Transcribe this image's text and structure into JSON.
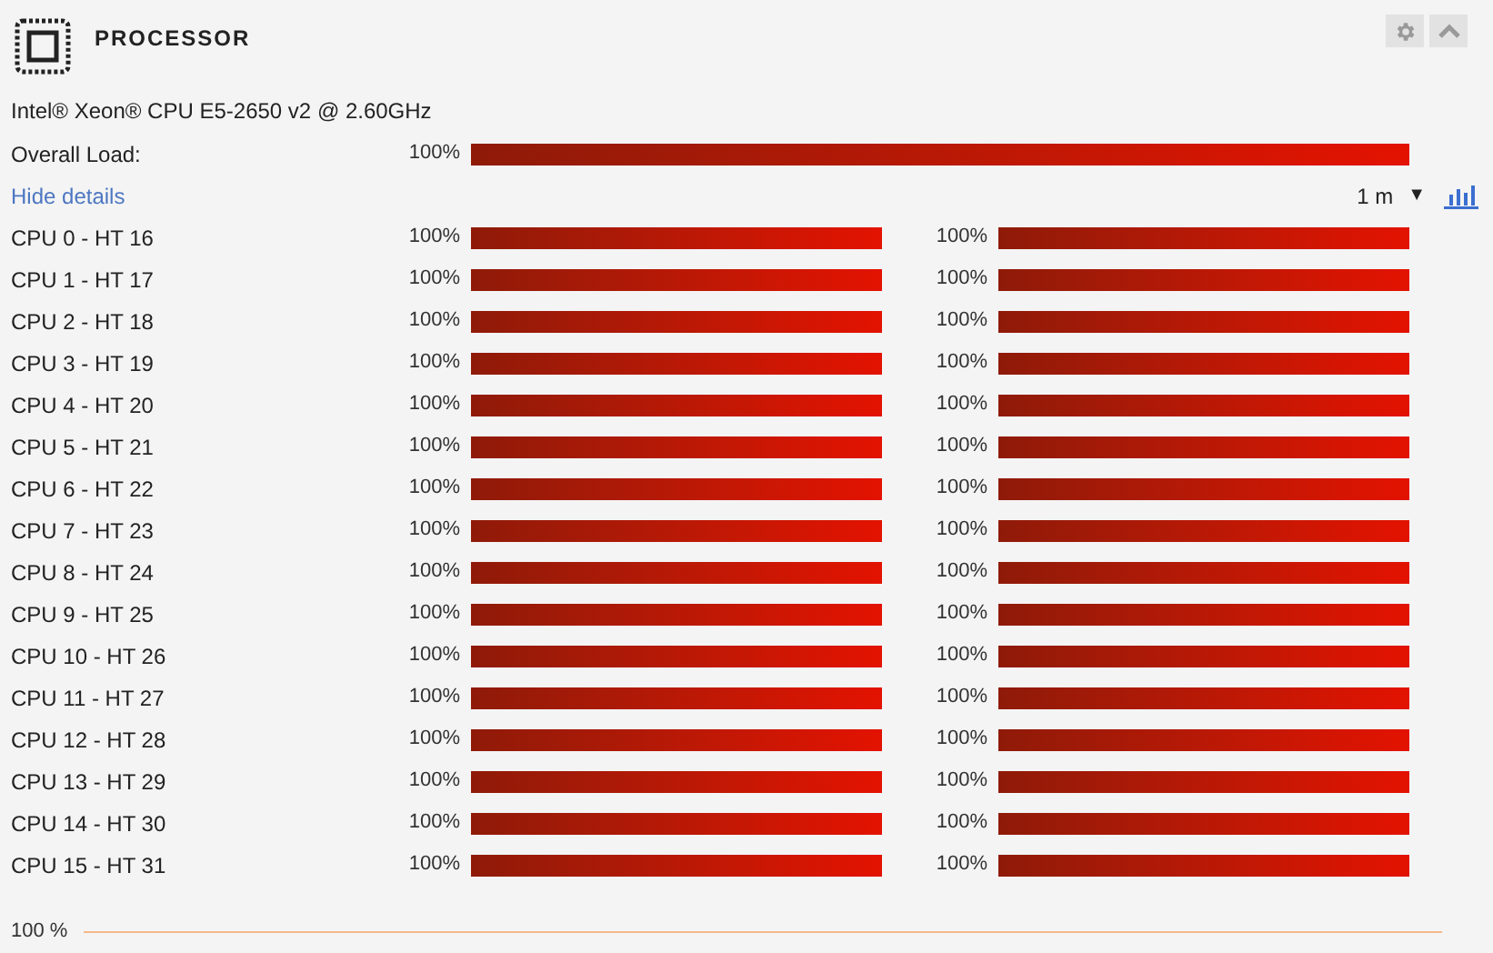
{
  "panel": {
    "title": "PROCESSOR"
  },
  "cpu_model": "Intel® Xeon® CPU E5-2650 v2 @ 2.60GHz",
  "overall": {
    "label": "Overall Load:",
    "reading": "100%"
  },
  "details_link": "Hide details",
  "interval": {
    "value": "1 m",
    "caret": "▼"
  },
  "cores": [
    {
      "name": "CPU 0 - HT 16",
      "cpu": {
        "reading": "100%"
      },
      "ht": {
        "reading": "100%"
      }
    },
    {
      "name": "CPU 1 - HT 17",
      "cpu": {
        "reading": "100%"
      },
      "ht": {
        "reading": "100%"
      }
    },
    {
      "name": "CPU 2 - HT 18",
      "cpu": {
        "reading": "100%"
      },
      "ht": {
        "reading": "100%"
      }
    },
    {
      "name": "CPU 3 - HT 19",
      "cpu": {
        "reading": "100%"
      },
      "ht": {
        "reading": "100%"
      }
    },
    {
      "name": "CPU 4 - HT 20",
      "cpu": {
        "reading": "100%"
      },
      "ht": {
        "reading": "100%"
      }
    },
    {
      "name": "CPU 5 - HT 21",
      "cpu": {
        "reading": "100%"
      },
      "ht": {
        "reading": "100%"
      }
    },
    {
      "name": "CPU 6 - HT 22",
      "cpu": {
        "reading": "100%"
      },
      "ht": {
        "reading": "100%"
      }
    },
    {
      "name": "CPU 7 - HT 23",
      "cpu": {
        "reading": "100%"
      },
      "ht": {
        "reading": "100%"
      }
    },
    {
      "name": "CPU 8 - HT 24",
      "cpu": {
        "reading": "100%"
      },
      "ht": {
        "reading": "100%"
      }
    },
    {
      "name": "CPU 9 - HT 25",
      "cpu": {
        "reading": "100%"
      },
      "ht": {
        "reading": "100%"
      }
    },
    {
      "name": "CPU 10 - HT 26",
      "cpu": {
        "reading": "100%"
      },
      "ht": {
        "reading": "100%"
      }
    },
    {
      "name": "CPU 11 - HT 27",
      "cpu": {
        "reading": "100%"
      },
      "ht": {
        "reading": "100%"
      }
    },
    {
      "name": "CPU 12 - HT 28",
      "cpu": {
        "reading": "100%"
      },
      "ht": {
        "reading": "100%"
      }
    },
    {
      "name": "CPU 13 - HT 29",
      "cpu": {
        "reading": "100%"
      },
      "ht": {
        "reading": "100%"
      }
    },
    {
      "name": "CPU 14 - HT 30",
      "cpu": {
        "reading": "100%"
      },
      "ht": {
        "reading": "100%"
      }
    },
    {
      "name": "CPU 15 - HT 31",
      "cpu": {
        "reading": "100%"
      },
      "ht": {
        "reading": "100%"
      }
    }
  ],
  "history": {
    "top_label": "100 %"
  }
}
